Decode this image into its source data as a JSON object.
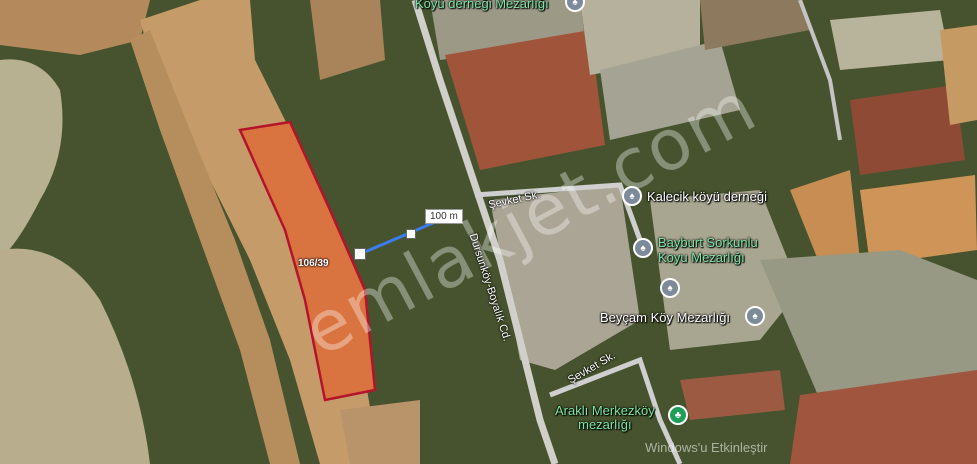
{
  "map": {
    "pois": [
      {
        "name": "Köyü derneği Mezarlığı",
        "icon": "cemetery-pin-icon"
      },
      {
        "name": "Kalecik köyü derneği",
        "icon": "cemetery-pin-icon"
      },
      {
        "name": "Bayburt Sorkunlu\nKoyu Mezarlığı",
        "icon": "cemetery-pin-icon"
      },
      {
        "name": "Beyçam Köy Mezarlığı",
        "icon": "cemetery-pin-icon"
      },
      {
        "name": "Araklı Merkezköy\nmezarlığı",
        "icon": "park-pin-icon"
      }
    ],
    "streets": {
      "sevket_1": "Şevket Sk.",
      "sevket_2": "Şevket Sk.",
      "main_road": "Dursunköy-Boyalık Cd."
    },
    "parcel": {
      "label": "106/39",
      "outline_color": "#b3132b",
      "fill_color": "#d9733f"
    },
    "measurement": {
      "distance": "100 m",
      "line_color": "#3d7bf0"
    }
  },
  "watermark": {
    "text": "emlakjet.com"
  },
  "windows_notice": {
    "text": "Windows'u Etkinleştir"
  }
}
